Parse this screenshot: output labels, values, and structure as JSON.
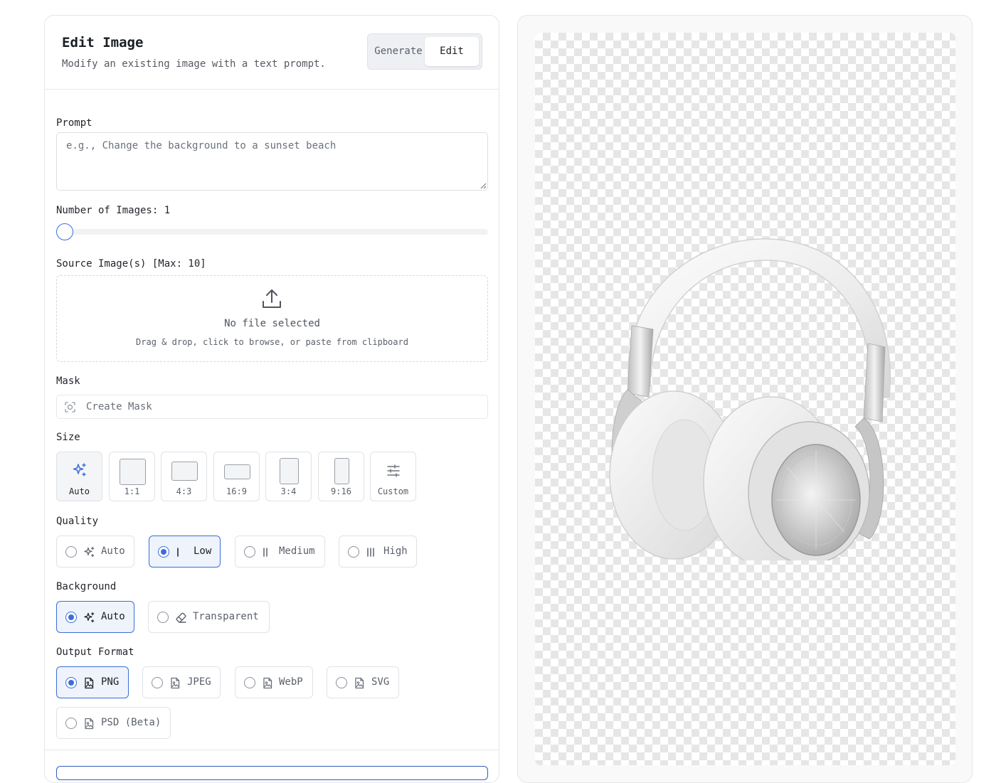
{
  "header": {
    "title": "Edit Image",
    "subtitle": "Modify an existing image with a text prompt.",
    "mode_tabs": [
      "Generate",
      "Edit"
    ],
    "active_mode": "Edit"
  },
  "prompt": {
    "label": "Prompt",
    "value": "",
    "placeholder": "e.g., Change the background to a sunset beach"
  },
  "num_images": {
    "label": "Number of Images: 1",
    "value": 1
  },
  "source": {
    "label": "Source Image(s) [Max: 10]",
    "status": "No file selected",
    "hint": "Drag & drop, click to browse, or paste from clipboard"
  },
  "mask": {
    "label": "Mask",
    "button": "Create Mask"
  },
  "size": {
    "label": "Size",
    "options": [
      "Auto",
      "1:1",
      "4:3",
      "16:9",
      "3:4",
      "9:16",
      "Custom"
    ],
    "selected": "Auto"
  },
  "quality": {
    "label": "Quality",
    "options": [
      "Auto",
      "Low",
      "Medium",
      "High"
    ],
    "selected": "Low"
  },
  "background": {
    "label": "Background",
    "options": [
      "Auto",
      "Transparent"
    ],
    "selected": "Auto"
  },
  "output_format": {
    "label": "Output Format",
    "options": [
      "PNG",
      "JPEG",
      "WebP",
      "SVG",
      "PSD (Beta)"
    ],
    "selected": "PNG"
  },
  "colors": {
    "accent": "#3b6ed8",
    "selected_bg": "#eef3fc"
  },
  "preview": {
    "subject_icon": "headphones-image"
  }
}
